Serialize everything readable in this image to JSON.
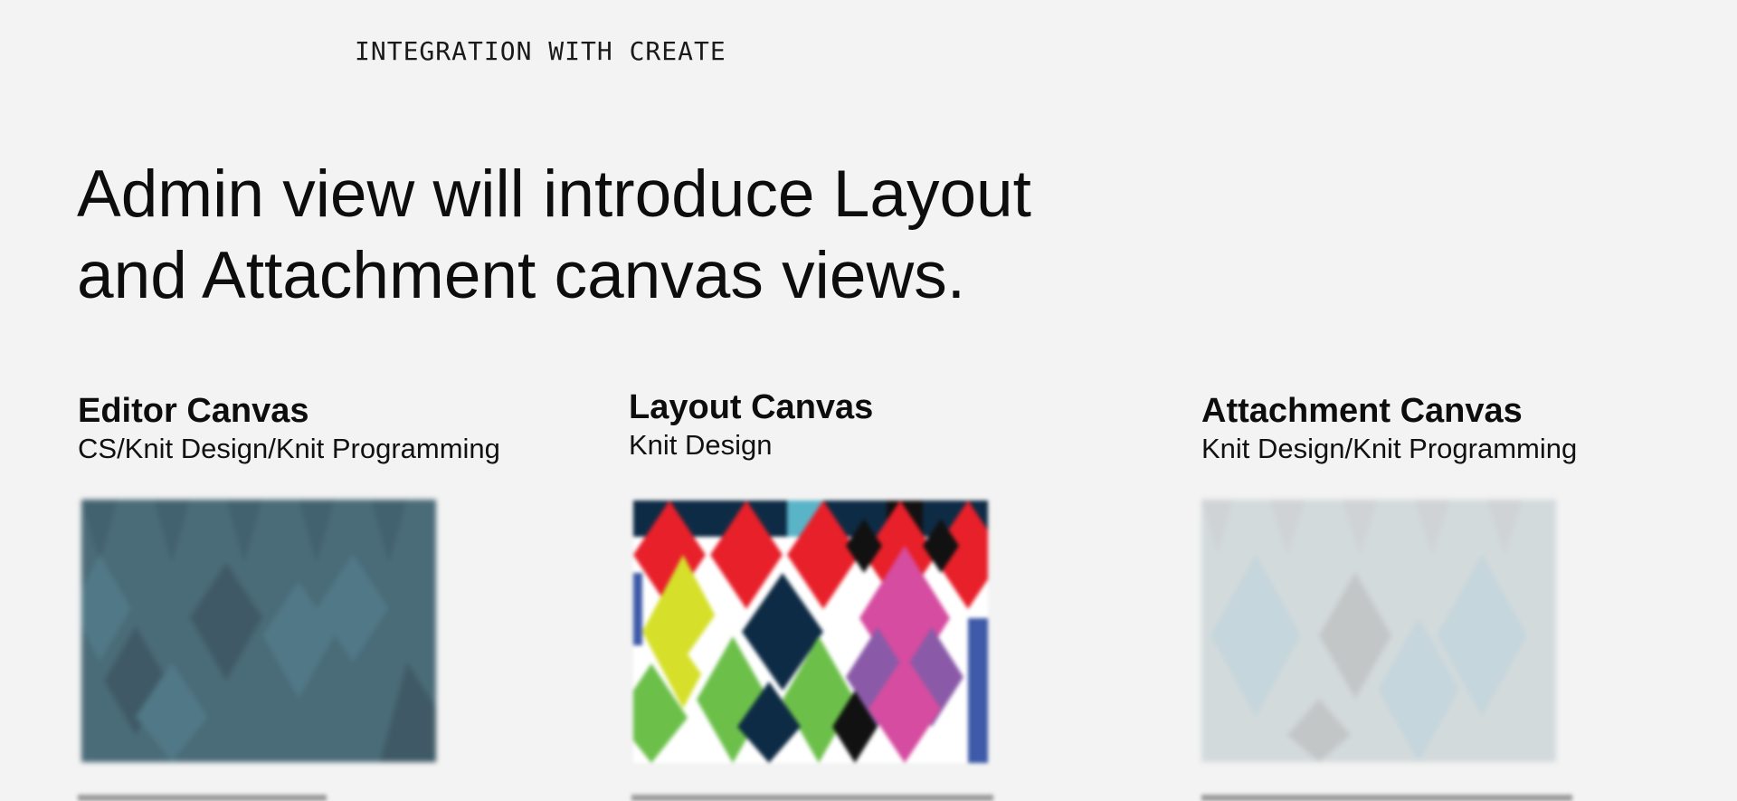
{
  "header": {
    "eyebrow": "INTEGRATION WITH CREATE",
    "headline_line1": "Admin view will introduce Layout",
    "headline_line2": "and Attachment canvas views."
  },
  "cards": [
    {
      "title": "Editor Canvas",
      "subtitle": "CS/Knit Design/Knit Programming",
      "thumb": "blurred-slate-argyle-image"
    },
    {
      "title": "Layout Canvas",
      "subtitle": "Knit Design",
      "thumb": "colorful-argyle-image"
    },
    {
      "title": "Attachment Canvas",
      "subtitle": "Knit Design/Knit Programming",
      "thumb": "blurred-pale-argyle-image"
    }
  ],
  "colors": {
    "background": "#f3f3f3",
    "editor_thumb": "#4a6b78",
    "red": "#e8202a",
    "navy": "#0e2b45",
    "green": "#6cc04a",
    "lime": "#d6e02a",
    "magenta": "#d64ca0",
    "purple": "#8a5aa8",
    "pale_blue": "#c9d9de"
  }
}
